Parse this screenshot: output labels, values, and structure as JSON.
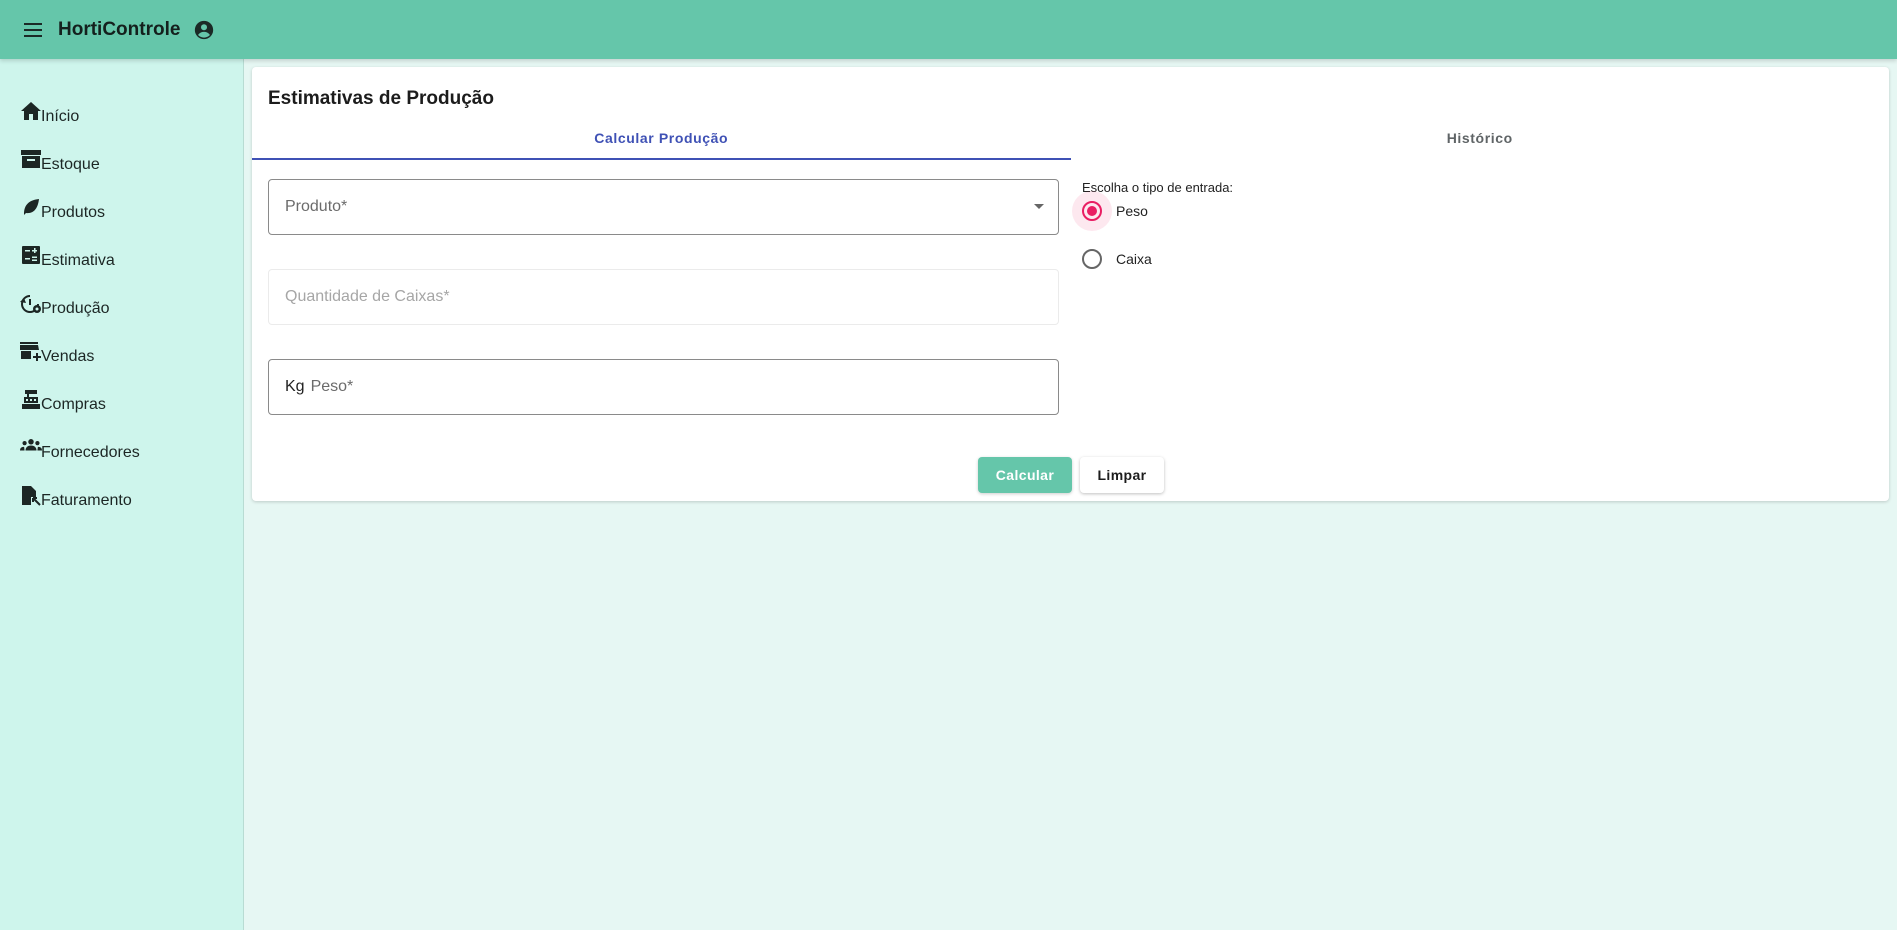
{
  "header": {
    "menu_icon": "menu-icon",
    "title": "HortiControle",
    "account_icon": "account-circle-icon",
    "bar_color": "#65c6aa"
  },
  "sidebar": {
    "items": [
      {
        "label": "Início",
        "icon": "home-icon"
      },
      {
        "label": "Estoque",
        "icon": "archive-icon"
      },
      {
        "label": "Produtos",
        "icon": "leaf-icon"
      },
      {
        "label": "Estimativa",
        "icon": "calculate-icon"
      },
      {
        "label": "Produção",
        "icon": "history-settings-icon"
      },
      {
        "label": "Vendas",
        "icon": "store-add-icon"
      },
      {
        "label": "Compras",
        "icon": "cash-register-icon"
      },
      {
        "label": "Fornecedores",
        "icon": "groups-icon"
      },
      {
        "label": "Faturamento",
        "icon": "invoice-icon"
      }
    ]
  },
  "main": {
    "title": "Estimativas de Produção",
    "tabs": [
      {
        "label": "Calcular Produção",
        "active": true
      },
      {
        "label": "Histórico",
        "active": false
      }
    ],
    "fields": {
      "produto": {
        "placeholder": "Produto*"
      },
      "caixas": {
        "placeholder": "Quantidade de Caixas*",
        "disabled": true
      },
      "peso": {
        "prefix": "Kg",
        "placeholder": "Peso*"
      }
    },
    "radio": {
      "title": "Escolha o tipo de entrada:",
      "options": [
        {
          "label": "Peso",
          "selected": true
        },
        {
          "label": "Caixa",
          "selected": false
        }
      ]
    },
    "buttons": {
      "calculate": "Calcular",
      "clear": "Limpar"
    }
  }
}
